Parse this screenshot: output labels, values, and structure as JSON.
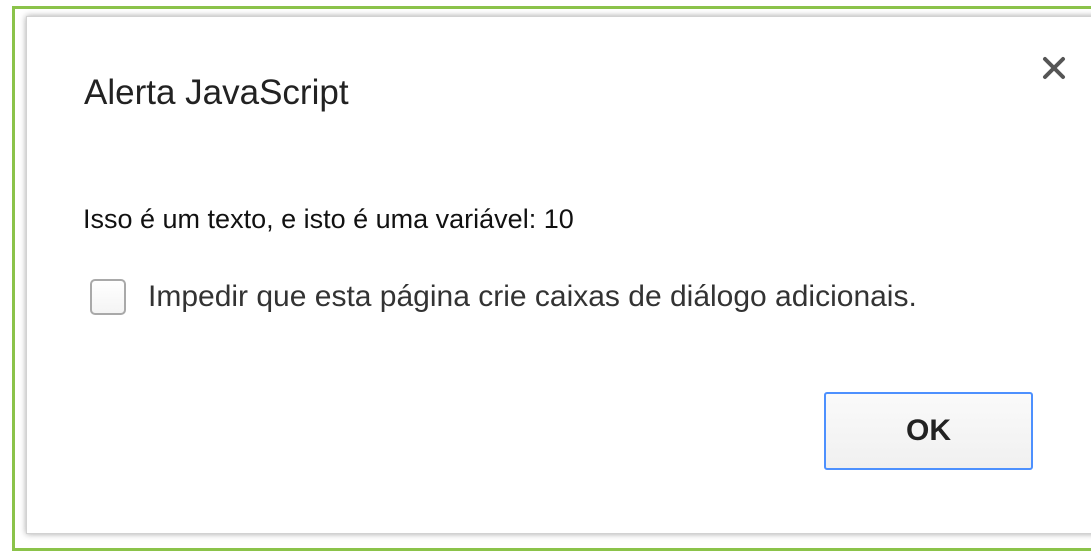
{
  "dialog": {
    "title": "Alerta JavaScript",
    "close_icon": "close-icon",
    "message": "Isso é um texto, e isto é uma variável: 10",
    "suppress_checkbox": {
      "label": "Impedir que esta página crie caixas de diálogo adicionais.",
      "checked": false
    },
    "ok_label": "OK"
  },
  "colors": {
    "frame_border": "#8bc34a",
    "ok_button_border": "#4d90fe",
    "title_text": "#222222"
  }
}
